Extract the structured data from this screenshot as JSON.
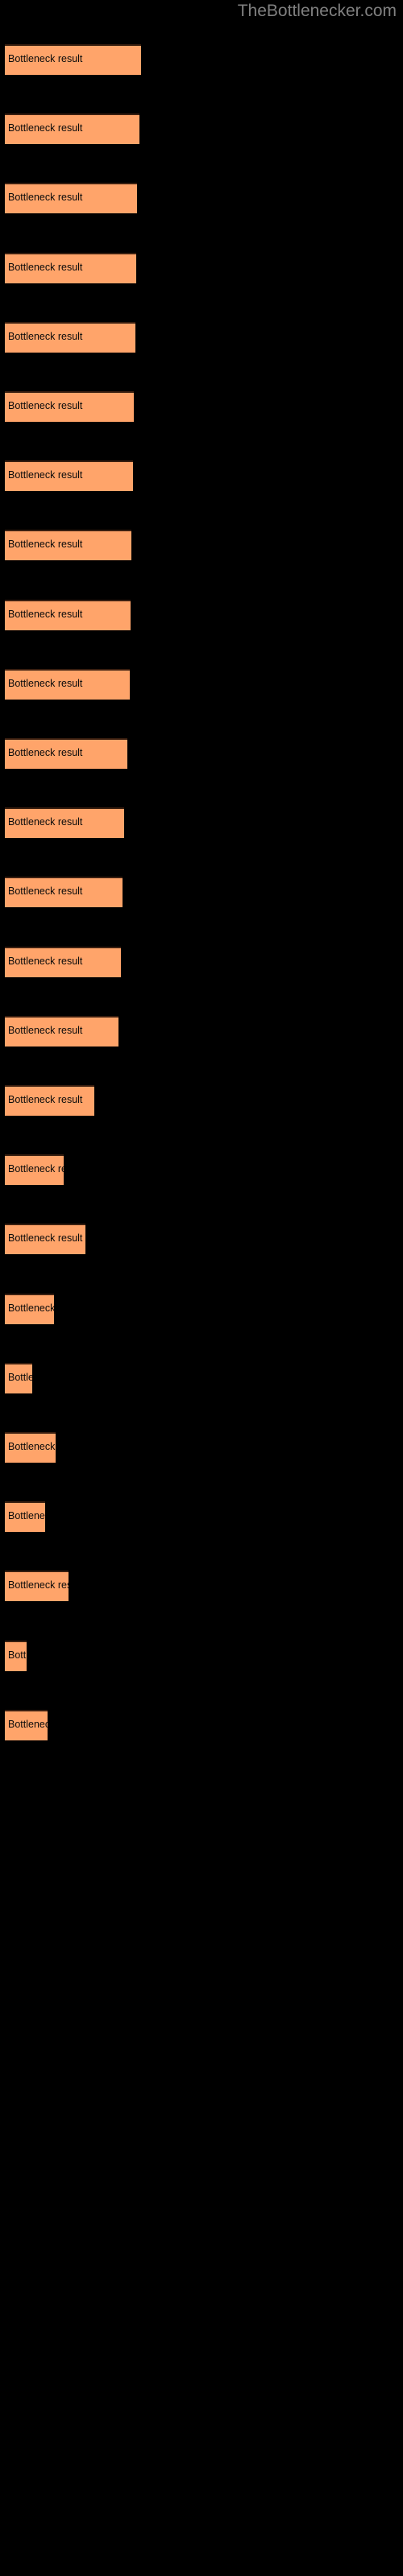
{
  "site": {
    "title": "TheBottlenecker.com",
    "title_color": "#808080"
  },
  "colors": {
    "background": "#000000",
    "bar_fill": "#ffa46a",
    "bar_border": "#3a1f10",
    "label_text": "#0b0b0b"
  },
  "chart_data": {
    "type": "bar",
    "orientation": "horizontal",
    "title": "",
    "subtitle": "",
    "xlabel": "",
    "ylabel": "",
    "grid": false,
    "legend": null,
    "axis_visible": false,
    "tick_labels": [],
    "bar_label_text": "Bottleneck result",
    "categories": [
      "Bottleneck result",
      "Bottleneck result",
      "Bottleneck result",
      "Bottleneck result",
      "Bottleneck result",
      "Bottleneck result",
      "Bottleneck result",
      "Bottleneck result",
      "Bottleneck result",
      "Bottleneck result",
      "Bottleneck result",
      "Bottleneck result",
      "Bottleneck result",
      "Bottleneck result",
      "Bottleneck result",
      "Bottleneck result",
      "Bottleneck result",
      "Bottleneck result",
      "Bottleneck result",
      "Bottleneck result",
      "Bottleneck result",
      "Bottleneck result"
    ],
    "values": [
      169,
      167,
      164,
      163,
      162,
      160,
      159,
      157,
      156,
      155,
      152,
      148,
      146,
      141,
      111,
      73,
      100,
      61,
      34,
      63,
      50,
      79,
      27,
      53
    ],
    "xlim": [
      0,
      500
    ]
  },
  "bars": [
    {
      "label": "Bottleneck result",
      "top": 55,
      "width": 169
    },
    {
      "label": "Bottleneck result",
      "top": 141,
      "width": 167
    },
    {
      "label": "Bottleneck result",
      "top": 227,
      "width": 164
    },
    {
      "label": "Bottleneck result",
      "top": 314,
      "width": 163
    },
    {
      "label": "Bottleneck result",
      "top": 400,
      "width": 162
    },
    {
      "label": "Bottleneck result",
      "top": 486,
      "width": 160
    },
    {
      "label": "Bottleneck result",
      "top": 572,
      "width": 159
    },
    {
      "label": "Bottleneck result",
      "top": 658,
      "width": 157
    },
    {
      "label": "Bottleneck result",
      "top": 745,
      "width": 156
    },
    {
      "label": "Bottleneck result",
      "top": 831,
      "width": 155
    },
    {
      "label": "Bottleneck result",
      "top": 917,
      "width": 152
    },
    {
      "label": "Bottleneck result",
      "top": 1003,
      "width": 148
    },
    {
      "label": "Bottleneck result",
      "top": 1089,
      "width": 146
    },
    {
      "label": "Bottleneck result",
      "top": 1176,
      "width": 144
    },
    {
      "label": "Bottleneck result",
      "top": 1262,
      "width": 141
    },
    {
      "label": "Bottleneck result",
      "top": 1348,
      "width": 111
    },
    {
      "label": "Bottleneck result",
      "top": 1434,
      "width": 73
    },
    {
      "label": "Bottleneck result",
      "top": 1520,
      "width": 100
    },
    {
      "label": "Bottleneck result",
      "top": 1607,
      "width": 61
    },
    {
      "label": "Bottleneck result",
      "top": 1693,
      "width": 34
    },
    {
      "label": "Bottleneck result",
      "top": 1779,
      "width": 63
    },
    {
      "label": "Bottleneck result",
      "top": 1865,
      "width": 50
    },
    {
      "label": "Bottleneck result",
      "top": 1951,
      "width": 79
    },
    {
      "label": "Bottleneck result",
      "top": 2038,
      "width": 27
    },
    {
      "label": "Bottleneck result",
      "top": 2124,
      "width": 53
    }
  ]
}
